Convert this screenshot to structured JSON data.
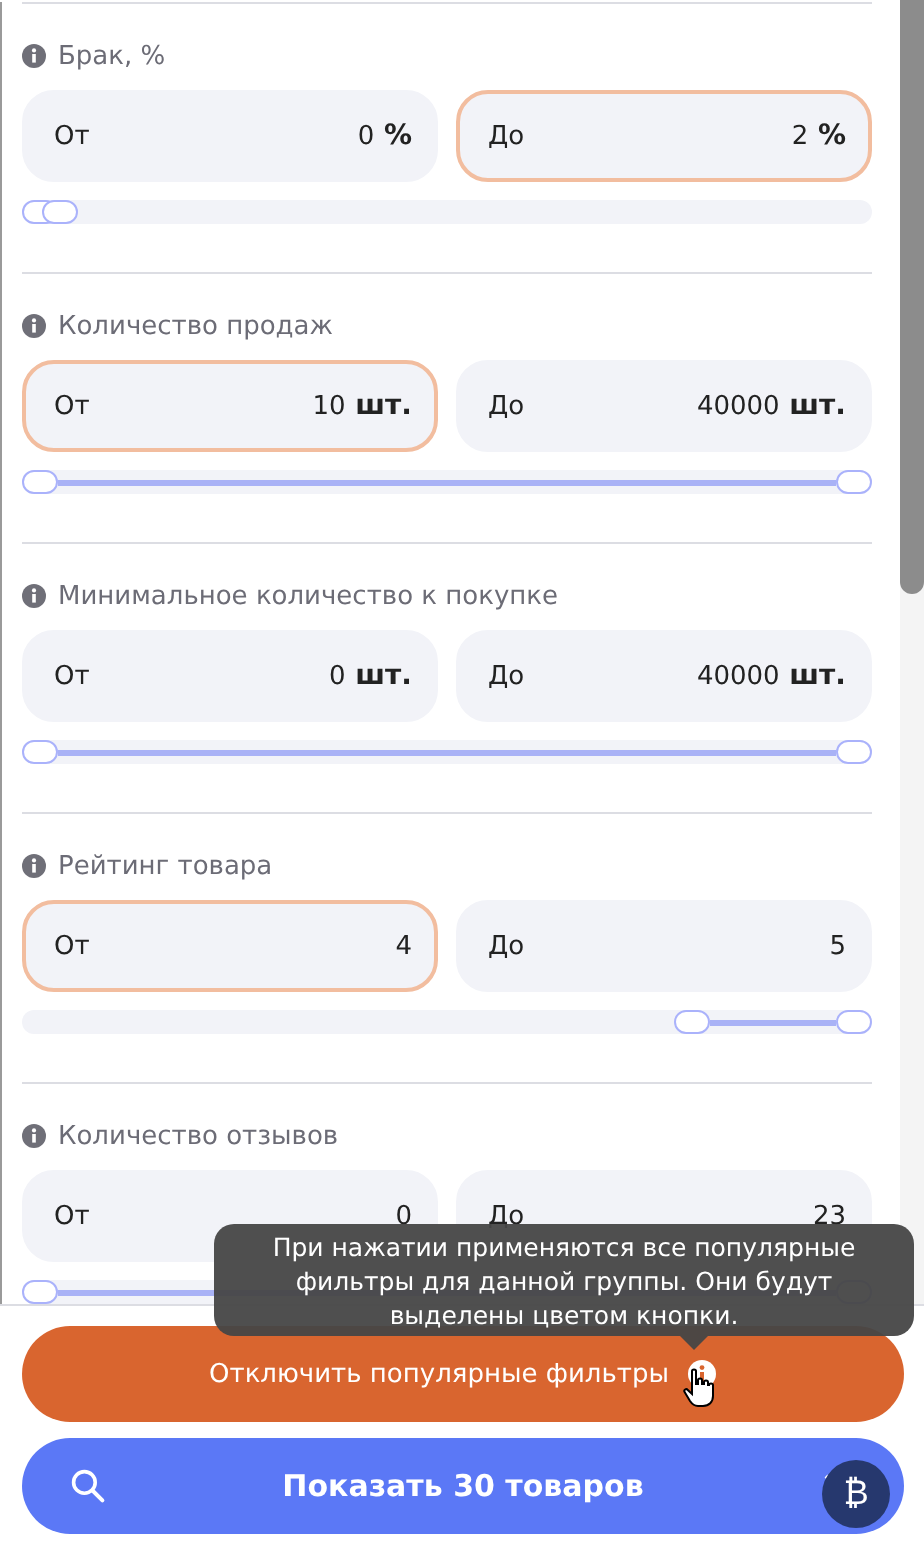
{
  "filters": [
    {
      "title": "Брак, %",
      "from": {
        "label": "От",
        "value": "0",
        "unit": "%",
        "highlighted": false
      },
      "to": {
        "label": "До",
        "value": "2",
        "unit": "%",
        "highlighted": true
      },
      "thumbs": [
        {
          "level": 0
        },
        {
          "level": 0.025
        }
      ]
    },
    {
      "title": "Количество продаж",
      "from": {
        "label": "От",
        "value": "10",
        "unit": "шт.",
        "highlighted": true
      },
      "to": {
        "label": "До",
        "value": "40000",
        "unit": "шт.",
        "highlighted": false
      },
      "thumbs": [
        {
          "level": 0
        },
        {
          "level": 1
        }
      ]
    },
    {
      "title": "Минимальное количество к покупке",
      "from": {
        "label": "От",
        "value": "0",
        "unit": "шт.",
        "highlighted": false
      },
      "to": {
        "label": "До",
        "value": "40000",
        "unit": "шт.",
        "highlighted": false
      },
      "thumbs": [
        {
          "level": 0
        },
        {
          "level": 1
        }
      ]
    },
    {
      "title": "Рейтинг товара",
      "from": {
        "label": "От",
        "value": "4",
        "highlighted": true
      },
      "to": {
        "label": "До",
        "value": "5",
        "highlighted": false
      },
      "thumbs": [
        {
          "level": 0.8
        },
        {
          "level": 1
        }
      ]
    },
    {
      "title": "Количество отзывов",
      "from": {
        "label": "От",
        "value": "0",
        "highlighted": false
      },
      "to": {
        "label": "До",
        "value": "23",
        "highlighted": false
      },
      "thumbs": [
        {
          "level": 0
        },
        {
          "level": 1
        }
      ]
    }
  ],
  "tooltip": "При нажатии применяются все популярные фильтры для данной группы. Они будут выделены цветом кнопки.",
  "disable_button": "Отключить популярные фильтры",
  "show_button": "Показать 30 товаров",
  "coin_badge": "₿"
}
